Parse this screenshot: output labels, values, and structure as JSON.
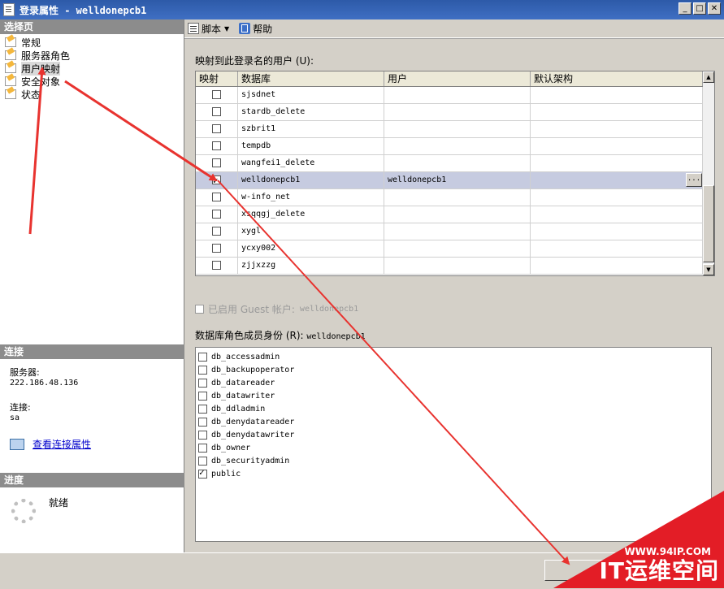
{
  "window": {
    "title": "登录属性 - welldonepcb1"
  },
  "left": {
    "select_page_header": "选择页",
    "pages": [
      {
        "label": "常规"
      },
      {
        "label": "服务器角色"
      },
      {
        "label": "用户映射"
      },
      {
        "label": "安全对象"
      },
      {
        "label": "状态"
      }
    ],
    "connection_header": "连接",
    "server_label": "服务器:",
    "server_value": "222.186.48.136",
    "connection_label": "连接:",
    "connection_value": "sa",
    "view_conn_link": "查看连接属性",
    "progress_header": "进度",
    "progress_status": "就绪"
  },
  "toolbar": {
    "script_label": "脚本",
    "help_label": "帮助"
  },
  "mapping": {
    "label": "映射到此登录名的用户 (U):",
    "columns": [
      "映射",
      "数据库",
      "用户",
      "默认架构"
    ],
    "rows": [
      {
        "db": "sjsdnet",
        "user": "",
        "schema": ""
      },
      {
        "db": "stardb_delete",
        "user": "",
        "schema": ""
      },
      {
        "db": "szbrit1",
        "user": "",
        "schema": ""
      },
      {
        "db": "tempdb",
        "user": "",
        "schema": ""
      },
      {
        "db": "wangfei1_delete",
        "user": "",
        "schema": ""
      },
      {
        "db": "welldonepcb1",
        "user": "welldonepcb1",
        "schema": ""
      },
      {
        "db": "w-info_net",
        "user": "",
        "schema": ""
      },
      {
        "db": "xsqqgj_delete",
        "user": "",
        "schema": ""
      },
      {
        "db": "xygl",
        "user": "",
        "schema": ""
      },
      {
        "db": "ycxy002",
        "user": "",
        "schema": ""
      },
      {
        "db": "zjjxzzg",
        "user": "",
        "schema": ""
      }
    ],
    "ellipsis": "..."
  },
  "guest": {
    "label": "已启用 Guest 帐户:",
    "value": "welldonepcb1"
  },
  "roles": {
    "label": "数据库角色成员身份 (R):",
    "login": "welldonepcb1",
    "items": [
      {
        "name": "db_accessadmin"
      },
      {
        "name": "db_backupoperator"
      },
      {
        "name": "db_datareader"
      },
      {
        "name": "db_datawriter"
      },
      {
        "name": "db_ddladmin"
      },
      {
        "name": "db_denydatareader"
      },
      {
        "name": "db_denydatawriter"
      },
      {
        "name": "db_owner"
      },
      {
        "name": "db_securityadmin"
      },
      {
        "name": "public"
      }
    ]
  },
  "watermark": {
    "url": "WWW.94IP.COM",
    "text": "IT运维空间"
  },
  "colors": {
    "arrow": "#e8332f",
    "selected_row": "#c6cbe0",
    "header": "#8c8c8c"
  }
}
